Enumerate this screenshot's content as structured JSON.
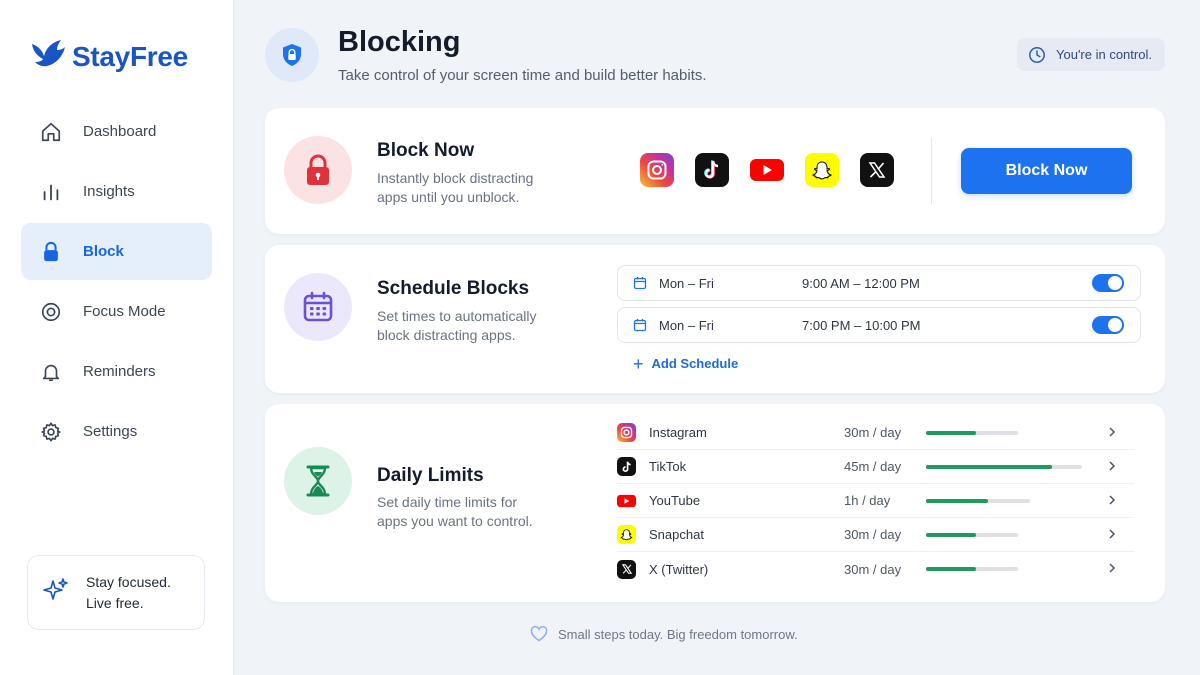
{
  "app": {
    "name": "StayFree"
  },
  "sidebar": {
    "items": [
      {
        "label": "Dashboard",
        "icon": "home-icon"
      },
      {
        "label": "Insights",
        "icon": "bar-chart-icon"
      },
      {
        "label": "Block",
        "icon": "lock-icon",
        "active": true
      },
      {
        "label": "Focus Mode",
        "icon": "target-icon"
      },
      {
        "label": "Reminders",
        "icon": "bell-icon"
      },
      {
        "label": "Settings",
        "icon": "gear-icon"
      }
    ],
    "focus_card": {
      "line1": "Stay focused.",
      "line2": "Live free.",
      "icon": "sparkle-icon"
    }
  },
  "header": {
    "title": "Blocking",
    "subtitle": "Take control of your screen time and build better habits.",
    "badge": "You're in control.",
    "icon": "shield-lock-icon"
  },
  "block_now": {
    "title": "Block Now",
    "desc_line1": "Instantly block distracting",
    "desc_line2": "apps until you unblock.",
    "apps": [
      "Instagram",
      "TikTok",
      "YouTube",
      "Snapchat",
      "X"
    ],
    "button": "Block Now"
  },
  "schedule": {
    "title": "Schedule Blocks",
    "desc_line1": "Set times to automatically",
    "desc_line2": "block distracting apps.",
    "rows": [
      {
        "days": "Mon – Fri",
        "time": "9:00 AM – 12:00 PM",
        "enabled": true
      },
      {
        "days": "Mon – Fri",
        "time": "7:00 PM – 10:00 PM",
        "enabled": true
      }
    ],
    "add_label": "Add Schedule"
  },
  "limits": {
    "title": "Daily Limits",
    "desc_line1": "Set daily time limits for",
    "desc_line2": "apps you want to control.",
    "rows": [
      {
        "name": "Instagram",
        "limit": "30m / day",
        "progress": 0.54
      },
      {
        "name": "TikTok",
        "limit": "45m / day",
        "progress": 0.81
      },
      {
        "name": "YouTube",
        "limit": "1h / day",
        "progress": 0.6
      },
      {
        "name": "Snapchat",
        "limit": "30m / day",
        "progress": 0.54
      },
      {
        "name": "X (Twitter)",
        "limit": "30m / day",
        "progress": 0.54
      }
    ]
  },
  "footer": {
    "text": "Small steps today. Big freedom tomorrow."
  },
  "colors": {
    "accent": "#1d72f0",
    "brand": "#1a55c4",
    "progress": "#1f9a5b"
  }
}
